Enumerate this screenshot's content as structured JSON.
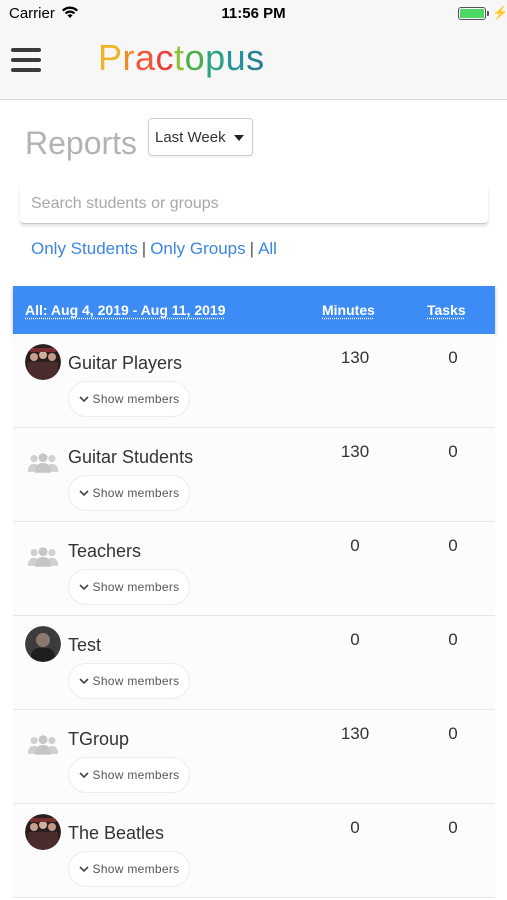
{
  "status_bar": {
    "carrier": "Carrier",
    "time": "11:56 PM",
    "battery_level": 1.0,
    "icons": [
      "wifi-icon",
      "battery-icon",
      "charging-icon"
    ]
  },
  "header": {
    "brand": "Practopus",
    "brand_letters": [
      {
        "ch": "P",
        "color": "#f0b429"
      },
      {
        "ch": "r",
        "color": "#f08a2a"
      },
      {
        "ch": "a",
        "color": "#ef5a3a"
      },
      {
        "ch": "c",
        "color": "#e8403b"
      },
      {
        "ch": "t",
        "color": "#8fc23f"
      },
      {
        "ch": "o",
        "color": "#4cae4c"
      },
      {
        "ch": "p",
        "color": "#2aa584"
      },
      {
        "ch": "u",
        "color": "#23949a"
      },
      {
        "ch": "s",
        "color": "#2a7f8f"
      }
    ],
    "menu_icon": "hamburger-menu-icon"
  },
  "reports": {
    "title": "Reports",
    "period": "Last Week"
  },
  "search": {
    "placeholder": "Search students or groups",
    "value": ""
  },
  "filters": {
    "only_students": "Only Students",
    "only_groups": "Only Groups",
    "all": "All",
    "separator": "|"
  },
  "table": {
    "range_header": "All: Aug 4, 2019 - Aug 11, 2019",
    "minutes_header": "Minutes",
    "tasks_header": "Tasks",
    "show_members_label": "Show members",
    "rows": [
      {
        "name": "Guitar Players",
        "minutes": "130",
        "tasks": "0",
        "icon": "photo-avatar"
      },
      {
        "name": "Guitar Students",
        "minutes": "130",
        "tasks": "0",
        "icon": "group-icon"
      },
      {
        "name": "Teachers",
        "minutes": "0",
        "tasks": "0",
        "icon": "group-icon"
      },
      {
        "name": "Test",
        "minutes": "0",
        "tasks": "0",
        "icon": "photo-avatar"
      },
      {
        "name": "TGroup",
        "minutes": "130",
        "tasks": "0",
        "icon": "group-icon"
      },
      {
        "name": "The Beatles",
        "minutes": "0",
        "tasks": "0",
        "icon": "photo-avatar"
      }
    ]
  },
  "colors": {
    "accent": "#3d8cf5",
    "link": "#3b86e0",
    "group_icon": "#d0d0d0"
  }
}
